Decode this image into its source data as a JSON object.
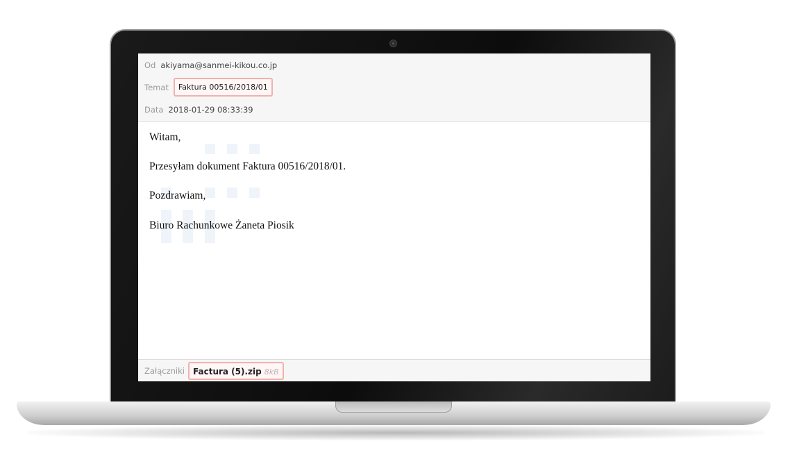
{
  "email": {
    "from_label": "Od",
    "from_value": "akiyama@sanmei-kikou.co.jp",
    "subject_label": "Temat",
    "subject_value": "Faktura 00516/2018/01",
    "date_label": "Data",
    "date_value": "2018-01-29 08:33:39",
    "body": {
      "greeting": "Witam,",
      "line1": "Przesyłam dokument Faktura 00516/2018/01.",
      "closing": "Pozdrawiam,",
      "signature": "Biuro Rachunkowe Żaneta Piosik"
    },
    "attachments_label": "Załączniki",
    "attachment": {
      "name": "Factura (5).zip",
      "size": "8kB"
    }
  },
  "colors": {
    "highlight_border": "#f2b0b0",
    "header_bg": "#f6f6f6",
    "bezel": "#111111"
  }
}
